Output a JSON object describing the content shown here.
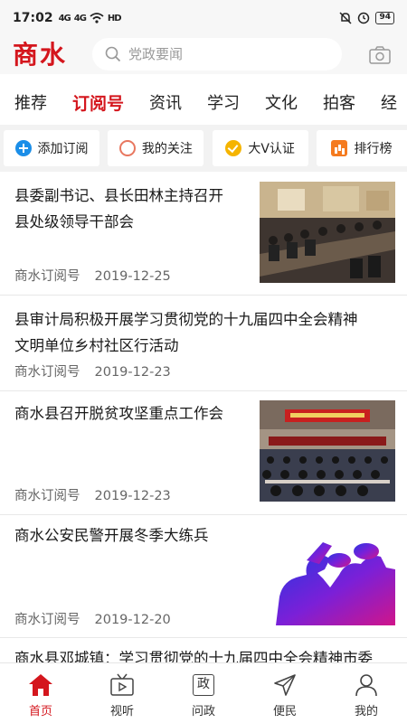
{
  "status_bar": {
    "time": "17:02",
    "signal1": "4G",
    "signal2": "4G",
    "hd_label": "HD",
    "battery": "94"
  },
  "header": {
    "logo": "商水",
    "search_placeholder": "党政要闻"
  },
  "tabs": [
    {
      "label": "推荐",
      "active": false
    },
    {
      "label": "订阅号",
      "active": true
    },
    {
      "label": "资讯",
      "active": false
    },
    {
      "label": "学习",
      "active": false
    },
    {
      "label": "文化",
      "active": false
    },
    {
      "label": "拍客",
      "active": false
    },
    {
      "label": "经",
      "active": false
    }
  ],
  "quick_actions": [
    {
      "label": "添加订阅",
      "icon": "add-icon"
    },
    {
      "label": "我的关注",
      "icon": "circle-icon"
    },
    {
      "label": "大V认证",
      "icon": "verified-icon"
    },
    {
      "label": "排行榜",
      "icon": "bar-chart-icon"
    }
  ],
  "news": [
    {
      "title_lines": [
        "县委副书记、县长田林主持召开",
        "县处级领导干部会"
      ],
      "source": "商水订阅号",
      "date": "2019-12-25",
      "thumb": "meeting-photo"
    },
    {
      "title_lines": [
        "县审计局积极开展学习贯彻党的十九届四中全会精神",
        "文明单位乡村社区行活动"
      ],
      "source": "商水订阅号",
      "date": "2019-12-23",
      "thumb": ""
    },
    {
      "title_lines": [
        "商水县召开脱贫攻坚重点工作会",
        ""
      ],
      "source": "商水订阅号",
      "date": "2019-12-23",
      "thumb": "conference-photo"
    },
    {
      "title_lines": [
        "商水公安民警开展冬季大练兵",
        ""
      ],
      "source": "商水订阅号",
      "date": "2019-12-20",
      "thumb": "police-salute-graphic"
    },
    {
      "title_lines": [
        "商水县邓城镇：学习贯彻党的十九届四中全会精神市委",
        ""
      ],
      "source": "",
      "date": "",
      "thumb": ""
    }
  ],
  "bottom_nav": [
    {
      "label": "首页",
      "icon": "home-icon",
      "active": true
    },
    {
      "label": "视听",
      "icon": "tv-icon",
      "active": false
    },
    {
      "label": "问政",
      "icon": "zheng-icon",
      "glyph": "政",
      "active": false
    },
    {
      "label": "便民",
      "icon": "send-icon",
      "active": false
    },
    {
      "label": "我的",
      "icon": "user-icon",
      "active": false
    }
  ],
  "colors": {
    "brand_red": "#d4161d",
    "background_gray": "#f2f2f2",
    "accent_blue": "#1b8ee8",
    "accent_gold": "#f5b400",
    "accent_orange": "#f57b1f",
    "police_purple": "#6b1fd6"
  }
}
